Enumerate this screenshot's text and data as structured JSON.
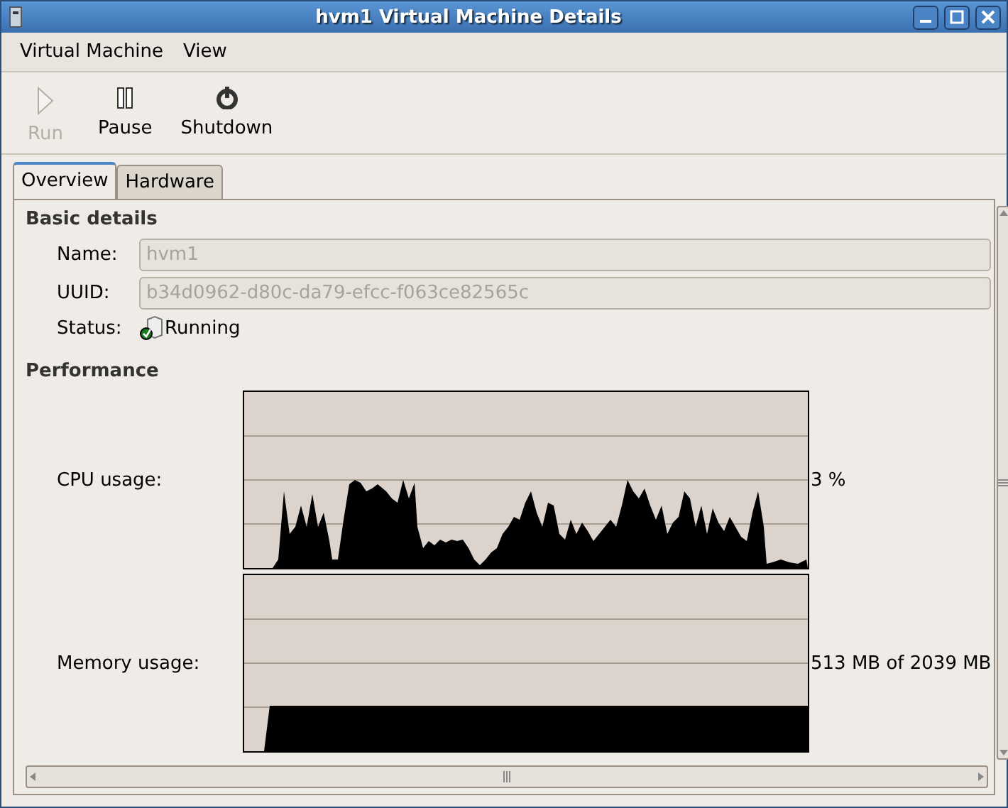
{
  "window": {
    "title": "hvm1 Virtual Machine Details"
  },
  "menu": [
    "Virtual Machine",
    "View"
  ],
  "toolbar": [
    {
      "kind": "run",
      "label": "Run",
      "disabled": true
    },
    {
      "kind": "pause",
      "label": "Pause",
      "disabled": false
    },
    {
      "kind": "shutdown",
      "label": "Shutdown",
      "disabled": false
    }
  ],
  "tabs": [
    {
      "label": "Overview",
      "selected": true
    },
    {
      "label": "Hardware",
      "selected": false
    }
  ],
  "basic_details": {
    "heading": "Basic details",
    "fields": [
      {
        "label": "Name:",
        "value": "hvm1",
        "disabled": true
      },
      {
        "label": "UUID:",
        "value": "b34d0962-d80c-da79-efcc-f063ce82565c",
        "disabled": true
      }
    ],
    "status": {
      "label": "Status:",
      "value": "Running"
    }
  },
  "performance": {
    "heading": "Performance",
    "graphs": [
      {
        "kind": "cpu",
        "label": "CPU usage:",
        "reading": "3 %"
      },
      {
        "kind": "memory",
        "label": "Memory usage:",
        "reading": "513 MB of 2039 MB"
      }
    ]
  }
}
